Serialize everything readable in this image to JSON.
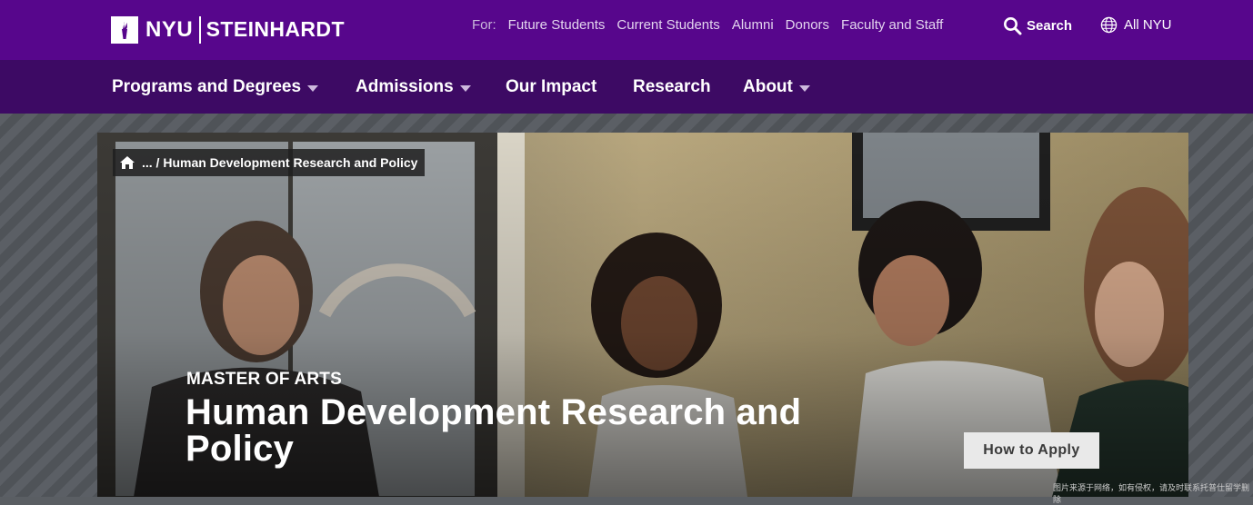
{
  "header": {
    "logo_nyu": "NYU",
    "logo_school": "STEINHARDT",
    "for_label": "For:",
    "audience_links": [
      "Future Students",
      "Current Students",
      "Alumni",
      "Donors",
      "Faculty and Staff"
    ],
    "search_label": "Search",
    "all_nyu_label": "All NYU"
  },
  "nav": {
    "items": [
      {
        "label": "Programs and Degrees",
        "dropdown": true
      },
      {
        "label": "Admissions",
        "dropdown": true
      },
      {
        "label": "Our Impact",
        "dropdown": false
      },
      {
        "label": "Research",
        "dropdown": false
      },
      {
        "label": "About",
        "dropdown": true
      }
    ]
  },
  "hero": {
    "breadcrumb": "... / Human Development Research and Policy",
    "eyebrow": "MASTER OF ARTS",
    "title": "Human Development Research and Policy",
    "apply_button": "How to Apply",
    "image_credit": "图片来源于网络，如有侵权，请及时联系托普仕留学删除"
  },
  "colors": {
    "brand_purple": "#57068c",
    "nav_purple": "#3d0a64"
  },
  "icons": [
    "nyu-torch-icon",
    "search-icon",
    "globe-icon",
    "home-icon",
    "caret-down-icon"
  ]
}
